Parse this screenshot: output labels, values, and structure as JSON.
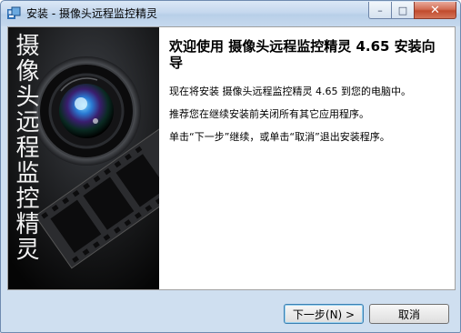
{
  "window": {
    "title": "安装 - 摄像头远程监控精灵",
    "minimize_glyph": "–",
    "maximize_glyph": "□",
    "close_glyph": "✕"
  },
  "side_panel": {
    "title": "摄像头远程监控精灵"
  },
  "main": {
    "heading": "欢迎使用 摄像头远程监控精灵 4.65 安装向导",
    "paragraphs": [
      "现在将安装 摄像头远程监控精灵 4.65 到您的电脑中。",
      "推荐您在继续安装前关闭所有其它应用程序。",
      "单击“下一步”继续，或单击“取消”退出安装程序。"
    ]
  },
  "buttons": {
    "next": "下一步(N) >",
    "cancel": "取消"
  }
}
